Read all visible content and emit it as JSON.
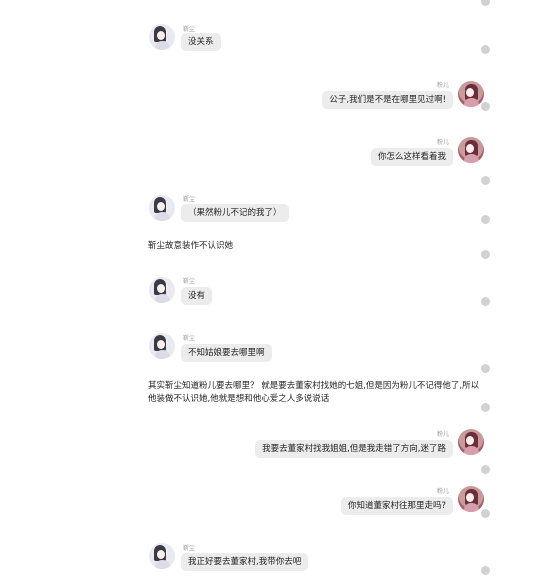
{
  "chat": {
    "messages": [
      {
        "name": "靳尘",
        "text": "没关系"
      },
      {
        "name": "粉儿",
        "text": "公子,我们是不是在哪里见过啊!"
      },
      {
        "name": "粉儿",
        "text": "你怎么这样看着我"
      },
      {
        "name": "靳尘",
        "text": "（果然粉儿不记的我了）"
      },
      {
        "name": "靳尘",
        "text": "没有"
      },
      {
        "name": "靳尘",
        "text": "不知姑娘要去哪里啊"
      },
      {
        "name": "粉儿",
        "text": "我要去董家村找我姐姐,但是我走错了方向,迷了路"
      },
      {
        "name": "粉儿",
        "text": "你知道董家村往那里走吗?"
      },
      {
        "name": "靳尘",
        "text": "我正好要去董家村,我带你去吧"
      }
    ],
    "narrations": [
      "靳尘故意装作不认识她",
      "其实靳尘知道粉儿要去哪里？ 就是要去董家村找她的七姐,但是因为粉儿不记得他了,所以",
      "他装做不认识她,他就是想和他心爱之人多说说话"
    ]
  }
}
